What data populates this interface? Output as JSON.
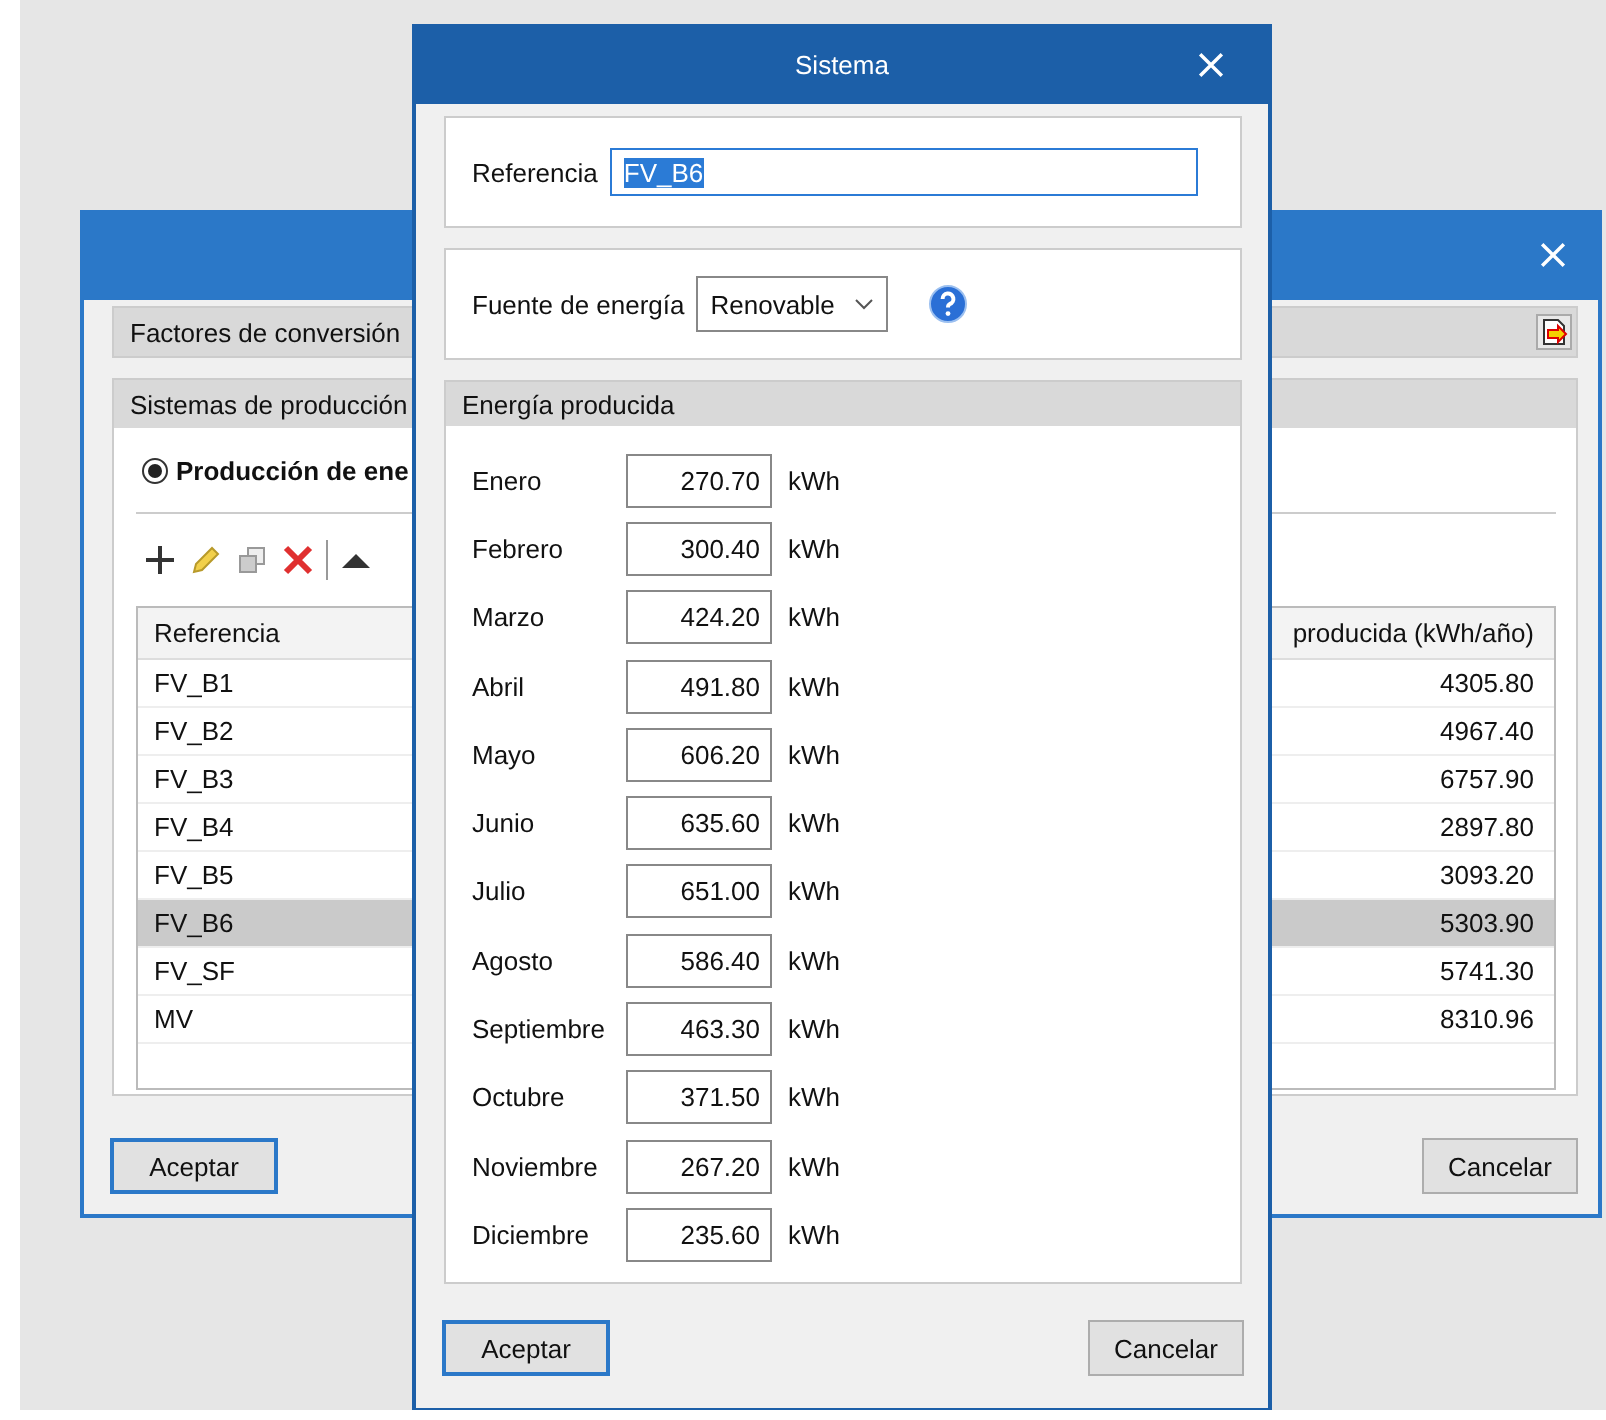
{
  "back_window": {
    "tabs": [
      {
        "label": "Factores de conversión"
      }
    ],
    "panel": {
      "title": "Sistemas de producción",
      "radio": {
        "label": "Producción de ene",
        "checked": true
      },
      "table": {
        "columns": [
          "Referencia",
          "producida (kWh/año)"
        ],
        "rows": [
          {
            "ref": "FV_B1",
            "value": "4305.80",
            "selected": false
          },
          {
            "ref": "FV_B2",
            "value": "4967.40",
            "selected": false
          },
          {
            "ref": "FV_B3",
            "value": "6757.90",
            "selected": false
          },
          {
            "ref": "FV_B4",
            "value": "2897.80",
            "selected": false
          },
          {
            "ref": "FV_B5",
            "value": "3093.20",
            "selected": false
          },
          {
            "ref": "FV_B6",
            "value": "5303.90",
            "selected": true
          },
          {
            "ref": "FV_SF",
            "value": "5741.30",
            "selected": false
          },
          {
            "ref": "MV",
            "value": "8310.96",
            "selected": false
          }
        ]
      }
    },
    "buttons": [
      {
        "label": "Aceptar",
        "default": true
      },
      {
        "label": "Cancelar",
        "default": false
      }
    ]
  },
  "dialog": {
    "title": "Sistema",
    "referencia": {
      "label": "Referencia",
      "value": "FV_B6",
      "text_selected": true
    },
    "fuente": {
      "label": "Fuente de energía",
      "value": "Renovable"
    },
    "energia": {
      "title": "Energía producida",
      "rows": [
        {
          "month": "Enero",
          "value": "270.70",
          "unit": "kWh"
        },
        {
          "month": "Febrero",
          "value": "300.40",
          "unit": "kWh"
        },
        {
          "month": "Marzo",
          "value": "424.20",
          "unit": "kWh"
        },
        {
          "month": "Abril",
          "value": "491.80",
          "unit": "kWh"
        },
        {
          "month": "Mayo",
          "value": "606.20",
          "unit": "kWh"
        },
        {
          "month": "Junio",
          "value": "635.60",
          "unit": "kWh"
        },
        {
          "month": "Julio",
          "value": "651.00",
          "unit": "kWh"
        },
        {
          "month": "Agosto",
          "value": "586.40",
          "unit": "kWh"
        },
        {
          "month": "Septiembre",
          "value": "463.30",
          "unit": "kWh"
        },
        {
          "month": "Octubre",
          "value": "371.50",
          "unit": "kWh"
        },
        {
          "month": "Noviembre",
          "value": "267.20",
          "unit": "kWh"
        },
        {
          "month": "Diciembre",
          "value": "235.60",
          "unit": "kWh"
        }
      ]
    },
    "buttons": [
      {
        "label": "Aceptar",
        "default": true
      },
      {
        "label": "Cancelar",
        "default": false
      }
    ]
  }
}
